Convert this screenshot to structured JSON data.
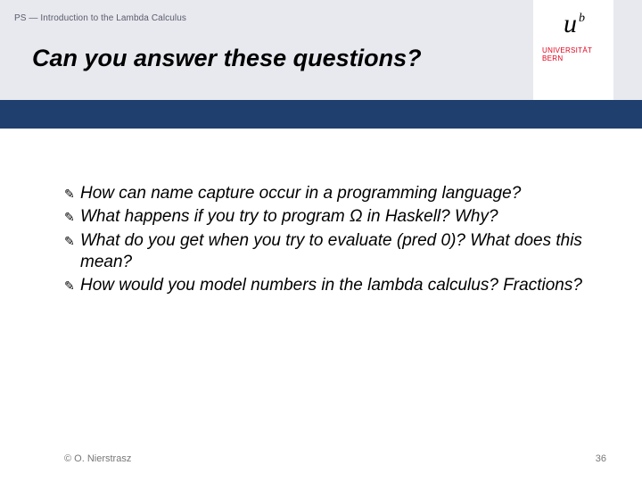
{
  "header": {
    "breadcrumb": "PS — Introduction to the Lambda Calculus",
    "title": "Can you answer these questions?"
  },
  "logo": {
    "mark_main": "u",
    "mark_sup": "b",
    "line1": "UNIVERSITÄT",
    "line2": "BERN"
  },
  "bullets": [
    "How can name capture occur in a programming language?",
    "What happens if you try to program Ω in Haskell? Why?",
    "What do you get when you try to evaluate (pred 0)? What does this mean?",
    "How would you model numbers in the lambda calculus? Fractions?"
  ],
  "bullet_glyph": "✎",
  "footer": {
    "copyright": "© O. Nierstrasz",
    "page_number": "36"
  }
}
